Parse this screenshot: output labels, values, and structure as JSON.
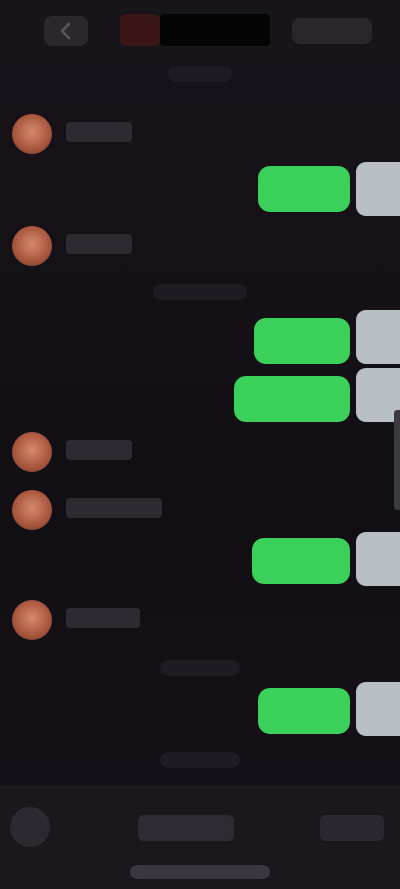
{
  "header": {
    "title": "",
    "back_icon": "chevron-left-icon",
    "more_icon": "more-icon"
  },
  "dates": [
    "",
    "",
    "",
    "",
    ""
  ],
  "messages": [
    {
      "side": "in",
      "name": ""
    },
    {
      "side": "out",
      "text": ""
    },
    {
      "side": "in",
      "name": ""
    },
    {
      "side": "out",
      "text": ""
    },
    {
      "side": "out",
      "text": ""
    },
    {
      "side": "in",
      "name": ""
    },
    {
      "side": "in",
      "name": ""
    },
    {
      "side": "out",
      "text": ""
    },
    {
      "side": "in",
      "name": ""
    },
    {
      "side": "out",
      "text": ""
    }
  ],
  "input": {
    "placeholder": ""
  },
  "colors": {
    "accent_green": "#3bd05a",
    "background": "#141116",
    "avatar": "#c46b4c"
  }
}
